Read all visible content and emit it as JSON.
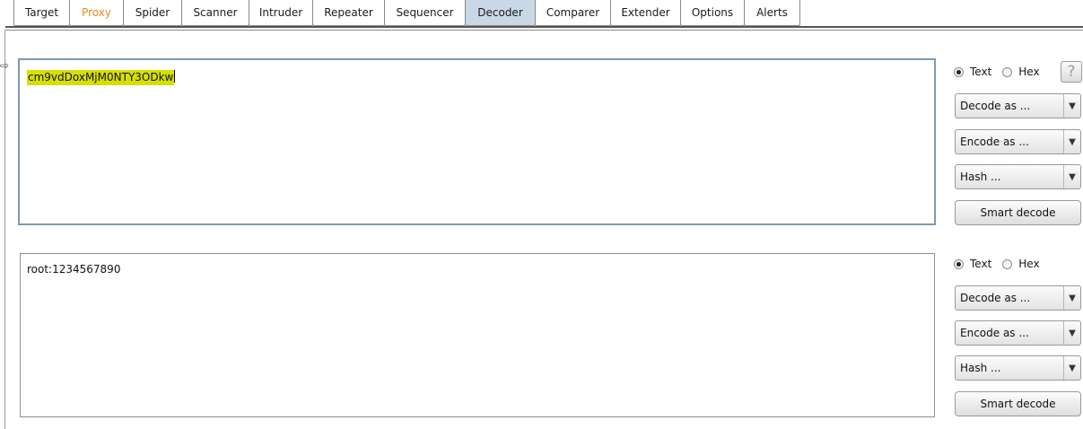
{
  "tabs": [
    {
      "label": "Target"
    },
    {
      "label": "Proxy"
    },
    {
      "label": "Spider"
    },
    {
      "label": "Scanner"
    },
    {
      "label": "Intruder"
    },
    {
      "label": "Repeater"
    },
    {
      "label": "Sequencer"
    },
    {
      "label": "Decoder"
    },
    {
      "label": "Comparer"
    },
    {
      "label": "Extender"
    },
    {
      "label": "Options"
    },
    {
      "label": "Alerts"
    }
  ],
  "active_tab": "Decoder",
  "colors": {
    "proxy_tab_text": "#e8891d",
    "active_tab_bg": "#c9d8e6",
    "selection_highlight": "#d7df00",
    "focused_border": "#7c9ab5"
  },
  "pane1": {
    "text": "cm9vdDoxMjM0NTY3ODkw",
    "selected": true,
    "mode_text": "Text",
    "mode_hex": "Hex",
    "mode_selected": "Text",
    "help": "?",
    "decode_label": "Decode as ...",
    "encode_label": "Encode as ...",
    "hash_label": "Hash ...",
    "smart_label": "Smart decode"
  },
  "pane2": {
    "text": "root:1234567890",
    "mode_text": "Text",
    "mode_hex": "Hex",
    "mode_selected": "Text",
    "decode_label": "Decode as ...",
    "encode_label": "Encode as ...",
    "hash_label": "Hash ...",
    "smart_label": "Smart decode"
  },
  "icons": {
    "dropdown": "triangle-down",
    "radio_selected": "filled-dot",
    "row_marker": "arrow-right"
  }
}
